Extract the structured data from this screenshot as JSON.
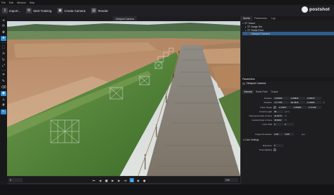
{
  "menu": [
    "File",
    "Edit",
    "Window",
    "Help"
  ],
  "toolbar": {
    "import_label": "Import...",
    "training_label": "Start Training",
    "camera_label": "Create Camera",
    "render_label": "Render"
  },
  "brand": {
    "name": "postshot"
  },
  "viewport": {
    "tab_label": "Viewport Camera"
  },
  "timeline": {
    "start_frame": "0",
    "end_frame": "100",
    "accent_color": "#2f8ed6"
  },
  "panel": {
    "tabs": [
      "Scene",
      "Preferences",
      "Log"
    ],
    "tree": [
      {
        "label": "Scene"
      },
      {
        "label": "Image Set"
      },
      {
        "label": "Radia Field"
      },
      {
        "label": "Viewport Camera"
      }
    ],
    "params_header": "Parameters",
    "params_title": "Viewport Camera",
    "param_tabs": [
      "General",
      "Radia Field",
      "Output"
    ],
    "rows": {
      "position": {
        "label": "Position",
        "v1": "-0.83050",
        "v2": "-0.38820",
        "v3": "-0.38370"
      },
      "rotation": {
        "label": "Rotation",
        "v1": "-17.7765",
        "v2": "-84.4815",
        "v3": "-2.18265"
      },
      "track_target": {
        "label": "Track Target",
        "v1": "-2.13567",
        "v2": "-0.68985",
        "v3": "-0.71348"
      },
      "focal_length": {
        "label": "Focal Length",
        "v1": "38"
      },
      "hfov": {
        "label": "Horizontal Field of View",
        "v1": "41.9270"
      },
      "vfov": {
        "label": "Vertical Field of View",
        "v1": "45.8001"
      },
      "lens_shift": {
        "label": "Lens Shift",
        "v1": "0",
        "v2": "0"
      },
      "image_resolution": {
        "label": "Image Resolution",
        "v1": "1781",
        "v2": "1788"
      },
      "color_settings": {
        "label": "Color Settings"
      },
      "exposure": {
        "label": "Exposure",
        "v1": "0"
      },
      "tonemapping": {
        "label": "Tonemapping"
      }
    },
    "units": {
      "angle": "[°]",
      "length": "[mm]",
      "pixels": "[px]"
    }
  }
}
